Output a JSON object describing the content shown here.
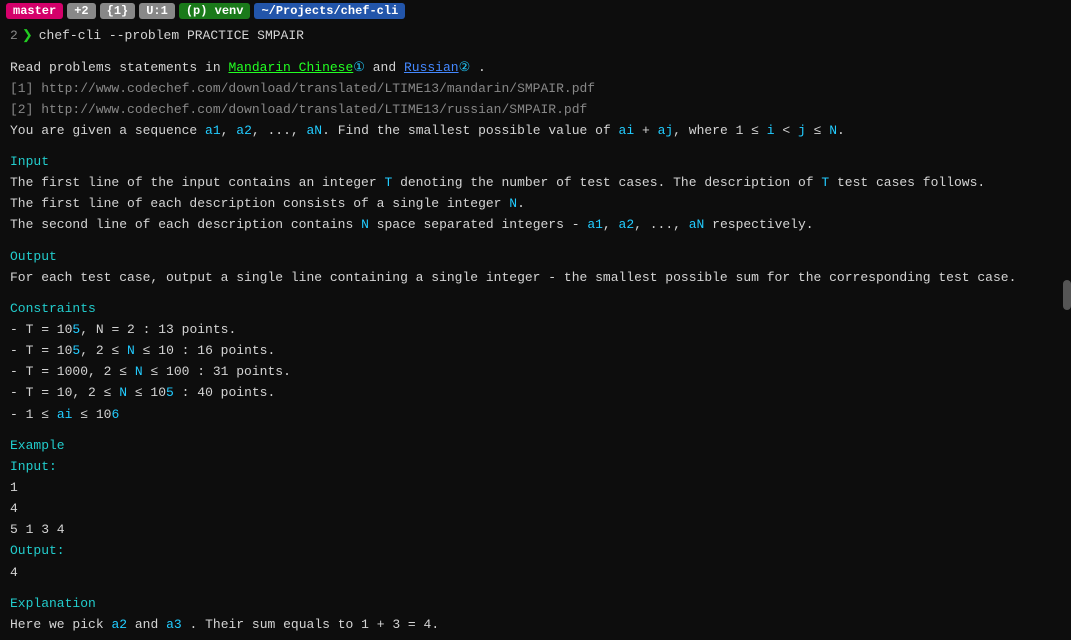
{
  "titlebar": {
    "branch": "master",
    "count": "+2",
    "indicator1": "{1}",
    "indicator2": "U:1",
    "venv": "(p) venv",
    "path": "~/Projects/chef-cli"
  },
  "lines": {
    "prompt1_num": "2",
    "prompt1_cmd": "chef-cli --problem PRACTICE SMPAIR",
    "intro": "Read problems statements in",
    "mandarin_link": "Mandarin Chinese",
    "and": "and",
    "russian_link": "Russian",
    "period": ".",
    "url1": "[1] http://www.codechef.com/download/translated/LTIME13/mandarin/SMPAIR.pdf",
    "url2": "[2] http://www.codechef.com/download/translated/LTIME13/russian/SMPAIR.pdf",
    "desc": "You are given a sequence a1, a2, ..., aN. Find the smallest possible value of",
    "desc2": "where 1 ≤ i < j ≤ N.",
    "ai_aj": "ai + aj,",
    "input_label": "Input",
    "input1": "The first line of the input contains an integer",
    "T1": "T",
    "input1b": "denoting the number of test cases. The description of",
    "T2": "T",
    "input1c": "test cases follows.",
    "input2": "The first line of each description consists of a single integer",
    "N1": "N",
    "input3": "The second line of each description contains",
    "N2": "N",
    "input3b": "space separated integers -",
    "a1": "a1,",
    "a2": "a2,",
    "aN": "aN",
    "input3c": "respectively.",
    "output_label": "Output",
    "output_text": "For each test case, output a single line containing a single integer - the smallest possible sum for the corresponding test case.",
    "constraints_label": "Constraints",
    "c1": "- T = 10",
    "c1b": "5",
    "c1c": ", N = 2 : 13 points.",
    "c2": "- T = 10",
    "c2b": "5",
    "c2c": ", 2 ≤ N ≤ 10 : 16 points.",
    "c3": "- T = 1000, 2 ≤ N ≤ 100 : 31 points.",
    "c4": "- T = 10, 2 ≤ N ≤ 10",
    "c4b": "5",
    "c4c": ": 40 points.",
    "c5": "- 1 ≤",
    "c5b": "ai",
    "c5c": "≤ 10",
    "c5d": "6",
    "example_label": "Example",
    "input_ex": "Input:",
    "ex_in1": "1",
    "ex_in2": "4",
    "ex_in3": "5 1 3 4",
    "output_ex": "Output:",
    "ex_out1": "4",
    "explanation_label": "Explanation",
    "explain": "Here we pick",
    "a2_ref": "a2",
    "explain2": "and",
    "a3_ref": "a3",
    "explain3": ". Their sum equals to 1 + 3 = 4."
  }
}
